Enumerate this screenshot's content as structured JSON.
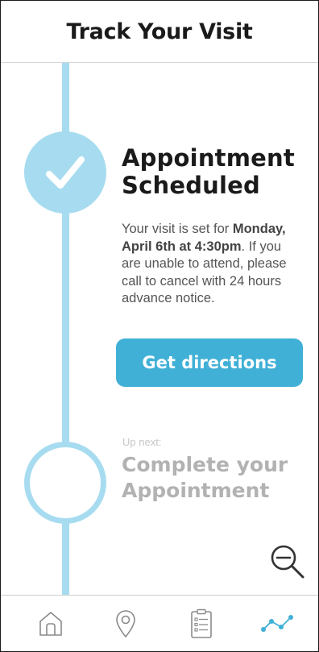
{
  "header": {
    "title": "Track Your Visit"
  },
  "steps": {
    "current": {
      "title_line1": "Appointment",
      "title_line2": "Scheduled",
      "status_icon": "check-icon",
      "desc_prefix": "Your visit is set for ",
      "desc_bold": "Monday, April 6th at 4:30pm",
      "desc_suffix": ". If you are unable to attend, please call to cancel with 24 hours advance notice.",
      "action_label": "Get directions"
    },
    "next": {
      "label": "Up next:",
      "title_line1": "Complete your",
      "title_line2": "Appointment"
    }
  },
  "zoom": {
    "icon": "zoom-out-icon"
  },
  "bottom_nav": {
    "items": [
      {
        "icon": "home-icon"
      },
      {
        "icon": "location-pin-icon"
      },
      {
        "icon": "clipboard-list-icon"
      },
      {
        "icon": "timeline-icon",
        "active": true
      }
    ]
  },
  "colors": {
    "timeline": "#a7dcf0",
    "accent": "#40b0d6",
    "nav_icon": "#8a8a8a",
    "nav_active": "#40b0d6"
  }
}
